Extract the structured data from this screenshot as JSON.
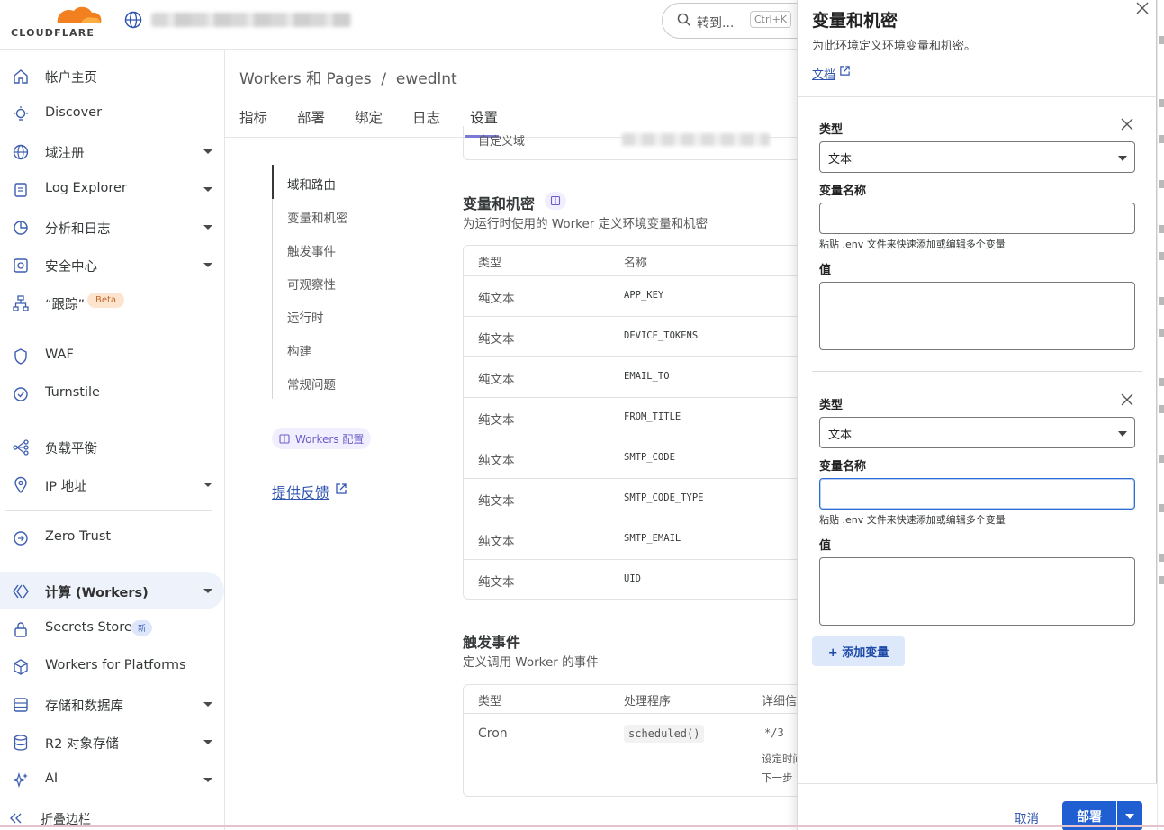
{
  "brand": {
    "logo_text": "CLOUDFLARE",
    "accent": "#f38020"
  },
  "header": {
    "search_label": "转到...",
    "search_shortcut": "Ctrl+K"
  },
  "sidebar": {
    "items": [
      {
        "label": "帐户主页",
        "icon": "home-icon"
      },
      {
        "label": "Discover",
        "icon": "lightbulb-icon"
      },
      {
        "label": "域注册",
        "icon": "globe-icon"
      },
      {
        "label": "Log Explorer",
        "icon": "log-icon"
      },
      {
        "label": "分析和日志",
        "icon": "chart-icon"
      },
      {
        "label": "安全中心",
        "icon": "shield-icon"
      },
      {
        "label": "“跟踪”",
        "icon": "trace-icon",
        "badge": "Beta"
      },
      {
        "label": "WAF",
        "icon": "waf-icon"
      },
      {
        "label": "Turnstile",
        "icon": "turnstile-icon"
      },
      {
        "label": "负载平衡",
        "icon": "load-balancer-icon"
      },
      {
        "label": "IP 地址",
        "icon": "location-icon"
      },
      {
        "label": "Zero Trust",
        "icon": "zero-trust-icon"
      },
      {
        "label": "计算 (Workers)",
        "icon": "workers-icon"
      },
      {
        "label": "Secrets Store",
        "icon": "lock-icon",
        "badge": "新"
      },
      {
        "label": "Workers for Platforms",
        "icon": "cube-icon"
      },
      {
        "label": "存储和数据库",
        "icon": "database-icon"
      },
      {
        "label": "R2 对象存储",
        "icon": "storage-icon"
      },
      {
        "label": "AI",
        "icon": "sparkle-icon"
      }
    ],
    "collapse_label": "折叠边栏"
  },
  "main": {
    "breadcrumb": "Workers 和 Pages  /  ewedlnt",
    "tabs": [
      "指标",
      "部署",
      "绑定",
      "日志",
      "设置"
    ],
    "active_tab": "设置",
    "subnav": [
      "域和路由",
      "变量和机密",
      "触发事件",
      "可观察性",
      "运行时",
      "构建",
      "常规问题"
    ],
    "config_pill": "Workers 配置",
    "feedback": "提供反馈",
    "custom_domain_label": "自定义域",
    "vars": {
      "title": "变量和机密",
      "subtitle": "为运行时使用的 Worker 定义环境变量和机密",
      "col_type": "类型",
      "col_name": "名称",
      "rows": [
        {
          "type": "纯文本",
          "name": "APP_KEY"
        },
        {
          "type": "纯文本",
          "name": "DEVICE_TOKENS"
        },
        {
          "type": "纯文本",
          "name": "EMAIL_TO"
        },
        {
          "type": "纯文本",
          "name": "FROM_TITLE"
        },
        {
          "type": "纯文本",
          "name": "SMTP_CODE"
        },
        {
          "type": "纯文本",
          "name": "SMTP_CODE_TYPE"
        },
        {
          "type": "纯文本",
          "name": "SMTP_EMAIL"
        },
        {
          "type": "纯文本",
          "name": "UID"
        }
      ]
    },
    "triggers": {
      "title": "触发事件",
      "subtitle": "定义调用 Worker 的事件",
      "col_type": "类型",
      "col_handler": "处理程序",
      "col_detail": "详细信",
      "row_type": "Cron",
      "row_handler": "scheduled()",
      "row_expr": "*/3",
      "row_line1": "设定时间",
      "row_line2": "下一步"
    }
  },
  "drawer": {
    "title": "变量和机密",
    "subtitle": "为此环境定义环境变量和机密。",
    "doc_link": "文档",
    "forms": [
      {
        "type_label": "类型",
        "type_value": "文本",
        "name_label": "变量名称",
        "name_value": "",
        "hint": "粘贴 .env 文件来快速添加或编辑多个变量",
        "value_label": "值"
      },
      {
        "type_label": "类型",
        "type_value": "文本",
        "name_label": "变量名称",
        "name_value": "",
        "hint": "粘贴 .env 文件来快速添加或编辑多个变量",
        "value_label": "值"
      }
    ],
    "add_button": "+ 添加变量",
    "cancel": "取消",
    "deploy": "部署"
  }
}
